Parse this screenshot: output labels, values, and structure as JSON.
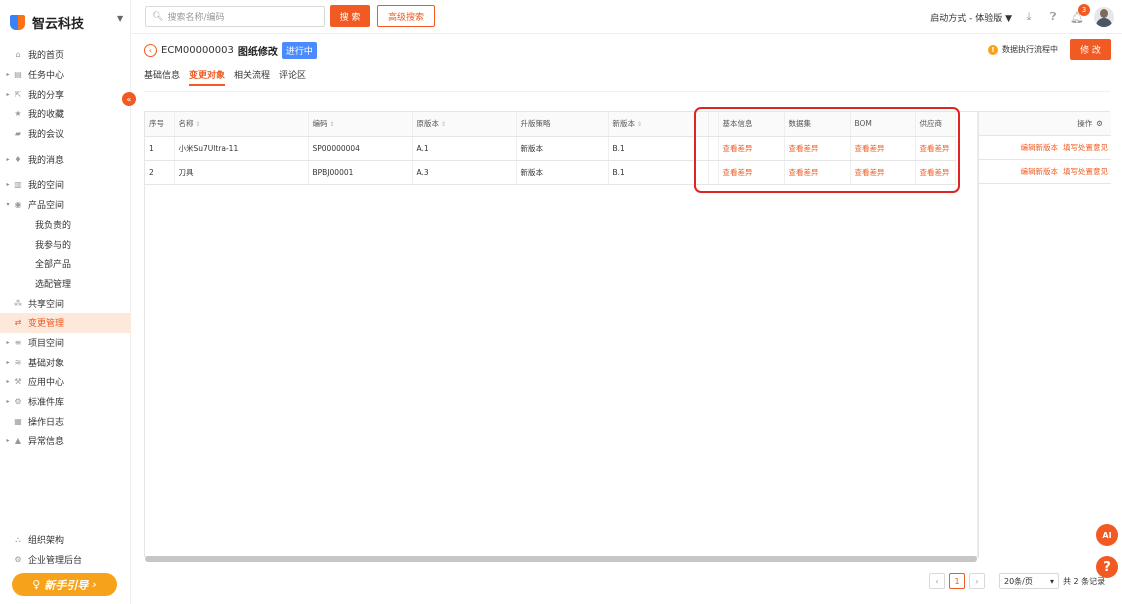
{
  "brand": {
    "name": "智云科技",
    "caret": "▼"
  },
  "sidebar": {
    "collapse_icon": "«",
    "items": [
      {
        "label": "我的首页",
        "icon": "home-icon",
        "glyph": "⌂",
        "arrow": ""
      },
      {
        "label": "任务中心",
        "icon": "task-icon",
        "glyph": "▤",
        "arrow": "▸"
      },
      {
        "label": "我的分享",
        "icon": "share-icon",
        "glyph": "⇱",
        "arrow": "▸"
      },
      {
        "label": "我的收藏",
        "icon": "star-icon",
        "glyph": "★",
        "arrow": ""
      },
      {
        "label": "我的会议",
        "icon": "video-icon",
        "glyph": "▰",
        "arrow": ""
      },
      {
        "label": "我的消息",
        "icon": "bell-icon",
        "glyph": "♦",
        "arrow": "▸"
      },
      {
        "label": "我的空间",
        "icon": "space-icon",
        "glyph": "▥",
        "arrow": "▸"
      },
      {
        "label": "产品空间",
        "icon": "product-icon",
        "glyph": "◉",
        "arrow": "▾"
      },
      {
        "label": "我负责的",
        "sub": true
      },
      {
        "label": "我参与的",
        "sub": true
      },
      {
        "label": "全部产品",
        "sub": true
      },
      {
        "label": "选配管理",
        "sub": true
      },
      {
        "label": "共享空间",
        "icon": "shared-icon",
        "glyph": "⁂",
        "arrow": ""
      },
      {
        "label": "变更管理",
        "icon": "change-icon",
        "glyph": "⇄",
        "arrow": "",
        "active": true
      },
      {
        "label": "项目空间",
        "icon": "project-icon",
        "glyph": "≡",
        "arrow": "▸"
      },
      {
        "label": "基础对象",
        "icon": "object-icon",
        "glyph": "≋",
        "arrow": "▸"
      },
      {
        "label": "应用中心",
        "icon": "app-icon",
        "glyph": "⚒",
        "arrow": "▸"
      },
      {
        "label": "标准件库",
        "icon": "standard-icon",
        "glyph": "⚙",
        "arrow": "▸"
      },
      {
        "label": "操作日志",
        "icon": "log-icon",
        "glyph": "▦",
        "arrow": ""
      },
      {
        "label": "异常信息",
        "icon": "warning-icon",
        "glyph": "▲",
        "arrow": "▸"
      }
    ],
    "bottom": [
      {
        "label": "组织架构",
        "icon": "org-icon",
        "glyph": "⛬"
      },
      {
        "label": "企业管理后台",
        "icon": "admin-icon",
        "glyph": "⚙"
      }
    ],
    "guide": {
      "label": "新手引导",
      "icon": "bulb-icon",
      "glyph": "♀",
      "arrow": "›"
    }
  },
  "topbar": {
    "search_placeholder": "搜索名称/编码",
    "search_button": "搜 索",
    "advanced_button": "高级搜索",
    "mode": "启动方式 - 体验版",
    "mode_caret": "▼",
    "notifications": "3"
  },
  "header": {
    "code": "ECM00000003",
    "title": "图纸修改",
    "status": "进行中",
    "flow_status": "数据执行流程中",
    "edit_button": "修 改"
  },
  "tabs": [
    {
      "label": "基础信息",
      "active": false
    },
    {
      "label": "变更对象",
      "active": true
    },
    {
      "label": "相关流程",
      "active": false
    },
    {
      "label": "评论区",
      "active": false
    }
  ],
  "table": {
    "columns": [
      {
        "label": "序号",
        "sort": false
      },
      {
        "label": "名称",
        "sort": true
      },
      {
        "label": "编码",
        "sort": true
      },
      {
        "label": "原版本",
        "sort": true
      },
      {
        "label": "升版策略",
        "sort": false
      },
      {
        "label": "新版本",
        "sort": true
      },
      {
        "label": "",
        "sort": false
      },
      {
        "label": "基本信息",
        "sort": false
      },
      {
        "label": "数据集",
        "sort": false
      },
      {
        "label": "BOM",
        "sort": false
      },
      {
        "label": "供应商",
        "sort": false
      }
    ],
    "rows": [
      {
        "no": "1",
        "name": "小米Su7Ultra-11",
        "code": "SP00000004",
        "old": "A.1",
        "strategy": "新版本",
        "new": "B.1",
        "diff1": "查看差异",
        "diff2": "查看差异",
        "diff3": "查看差异",
        "diff4": "查看差异"
      },
      {
        "no": "2",
        "name": "刀具",
        "code": "BPBJ00001",
        "old": "A.3",
        "strategy": "新版本",
        "new": "B.1",
        "diff1": "查看差异",
        "diff2": "查看差异",
        "diff3": "查看差异",
        "diff4": "查看差异"
      }
    ],
    "ops_header": "操作",
    "ops": [
      {
        "a": "编辑新版本",
        "b": "填写处置意见"
      },
      {
        "a": "编辑新版本",
        "b": "填写处置意见"
      }
    ]
  },
  "pagination": {
    "prev": "‹",
    "current": "1",
    "next": "›",
    "page_size": "20条/页",
    "total": "共 2 条记录"
  },
  "fabs": {
    "ai": "AI",
    "help": "?"
  }
}
